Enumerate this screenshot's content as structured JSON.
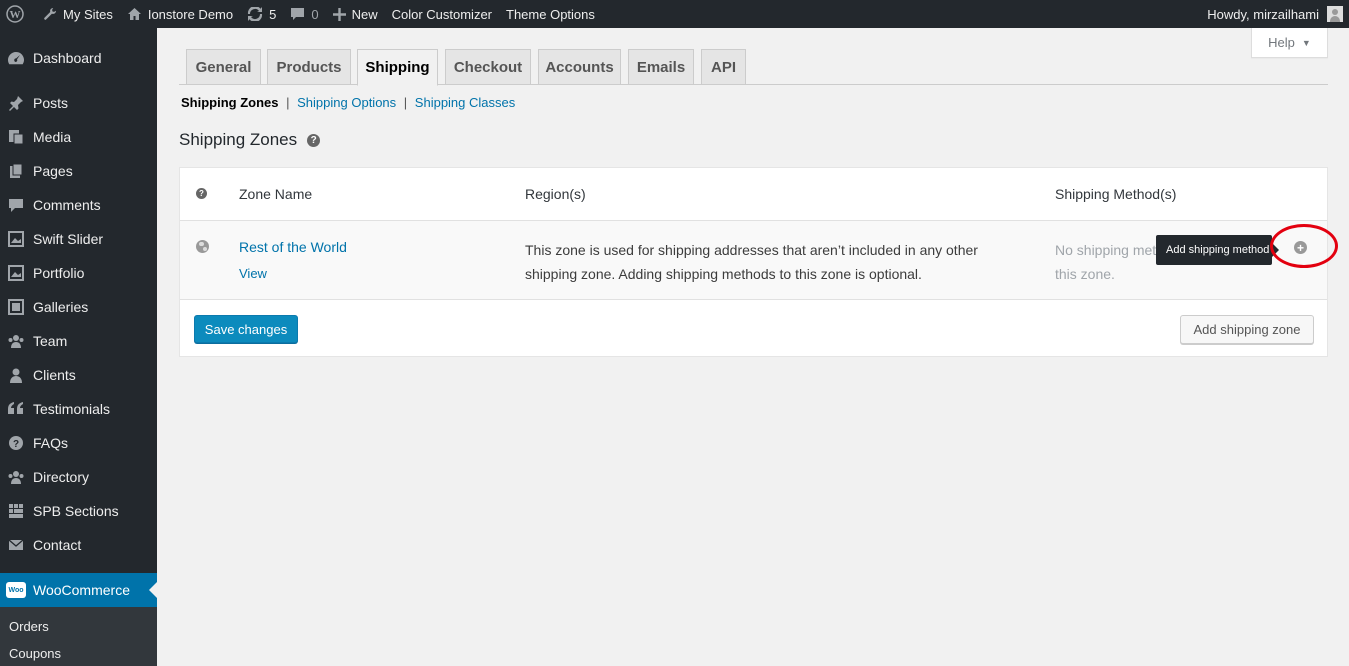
{
  "adminbar": {
    "my_sites": "My Sites",
    "site_name": "Ionstore Demo",
    "updates_count": "5",
    "comments_count": "0",
    "new_label": "New",
    "color_customizer": "Color Customizer",
    "theme_options": "Theme Options",
    "howdy": "Howdy, mirzailhami"
  },
  "sidebar": {
    "items": [
      {
        "label": "Dashboard",
        "icon": "dashboard-icon"
      },
      {
        "label": "Posts",
        "icon": "pin-icon"
      },
      {
        "label": "Media",
        "icon": "media-icon"
      },
      {
        "label": "Pages",
        "icon": "pages-icon"
      },
      {
        "label": "Comments",
        "icon": "comment-icon"
      },
      {
        "label": "Swift Slider",
        "icon": "slider-icon"
      },
      {
        "label": "Portfolio",
        "icon": "portfolio-icon"
      },
      {
        "label": "Galleries",
        "icon": "gallery-icon"
      },
      {
        "label": "Team",
        "icon": "team-icon"
      },
      {
        "label": "Clients",
        "icon": "user-icon"
      },
      {
        "label": "Testimonials",
        "icon": "quote-icon"
      },
      {
        "label": "FAQs",
        "icon": "help-icon"
      },
      {
        "label": "Directory",
        "icon": "directory-icon"
      },
      {
        "label": "SPB Sections",
        "icon": "grid-icon"
      },
      {
        "label": "Contact",
        "icon": "mail-icon"
      }
    ],
    "active_item": {
      "label": "WooCommerce",
      "icon": "woocommerce-icon",
      "logo_text": "Woo"
    },
    "submenu": [
      "Orders",
      "Coupons"
    ]
  },
  "help_tab": {
    "label": "Help"
  },
  "tabs": [
    {
      "label": "General",
      "active": false
    },
    {
      "label": "Products",
      "active": false
    },
    {
      "label": "Shipping",
      "active": true
    },
    {
      "label": "Checkout",
      "active": false
    },
    {
      "label": "Accounts",
      "active": false
    },
    {
      "label": "Emails",
      "active": false
    },
    {
      "label": "API",
      "active": false
    }
  ],
  "subnav": {
    "current": "Shipping Zones",
    "links": [
      "Shipping Options",
      "Shipping Classes"
    ],
    "separator": "|"
  },
  "heading": "Shipping Zones",
  "table": {
    "columns": [
      "Zone Name",
      "Region(s)",
      "Shipping Method(s)"
    ],
    "help_glyph": "?",
    "row": {
      "zone_name": "Rest of the World",
      "view_link": "View",
      "region": "This zone is used for shipping addresses that aren’t included in any other shipping zone. Adding shipping methods to this zone is optional.",
      "methods_line1": "No shipping methods offered to",
      "methods_line2": "this zone.",
      "tooltip": "Add shipping method",
      "add_glyph": "+"
    },
    "save_button": "Save changes",
    "add_zone_button": "Add shipping zone"
  },
  "colors": {
    "adminbar_bg": "#23282d",
    "accent": "#0073aa",
    "primary_button": "#0085ba",
    "highlight_ring": "#e3000f"
  }
}
